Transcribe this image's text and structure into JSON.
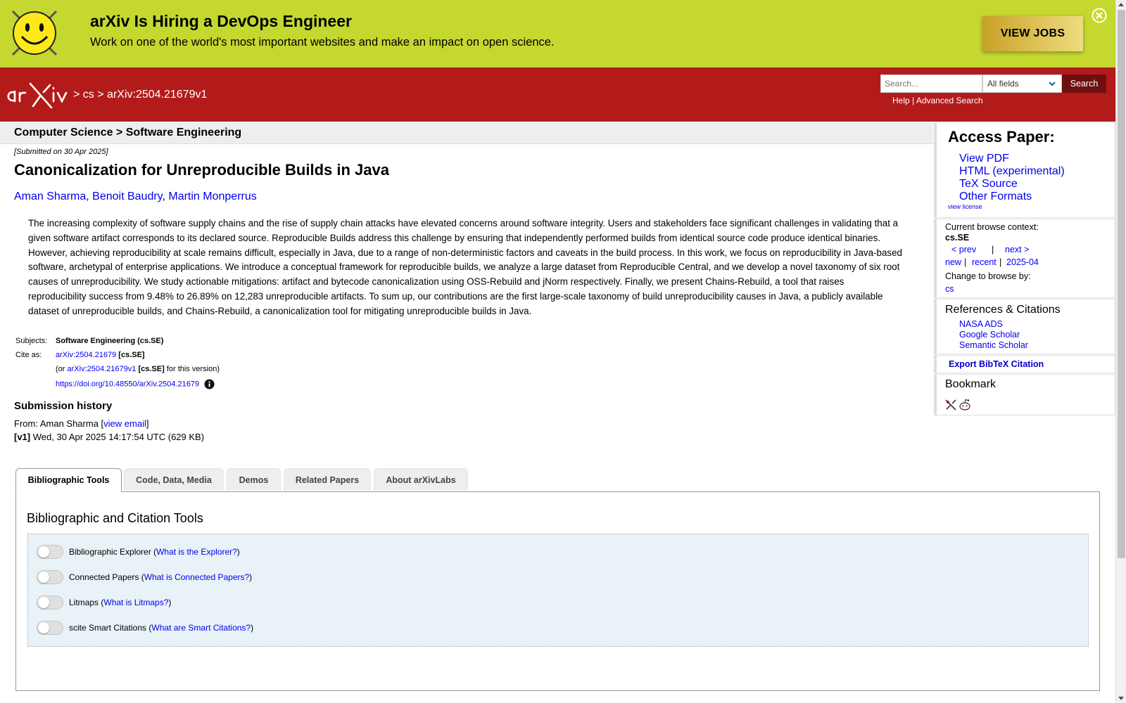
{
  "banner": {
    "title": "arXiv Is Hiring a DevOps Engineer",
    "text": "Work on one of the world's most important websites and make an impact on open science.",
    "button": "VIEW JOBS"
  },
  "header": {
    "crumb_sep": ">",
    "crumb_cs": "cs",
    "crumb_id": "arXiv:2504.21679v1",
    "search_placeholder": "Search...",
    "search_field": "All fields",
    "search_button": "Search",
    "help": "Help",
    "link_sep": "|",
    "advanced": "Advanced Search"
  },
  "paper": {
    "subject_bar": "Computer Science > Software Engineering",
    "submitted": "[Submitted on 30 Apr 2025]",
    "title": "Canonicalization for Unreproducible Builds in Java",
    "authors": [
      "Aman Sharma",
      "Benoit Baudry",
      "Martin Monperrus"
    ],
    "abstract": "The increasing complexity of software supply chains and the rise of supply chain attacks have elevated concerns around software integrity. Users and stakeholders face significant challenges in validating that a given software artifact corresponds to its declared source. Reproducible Builds address this challenge by ensuring that independently performed builds from identical source code produce identical binaries. However, achieving reproducibility at scale remains difficult, especially in Java, due to a range of non-deterministic factors and caveats in the build process. In this work, we focus on reproducibility in Java-based software, archetypal of enterprise applications. We introduce a conceptual framework for reproducible builds, we analyze a large dataset from Reproducible Central, and we develop a novel taxonomy of six root causes of unreproducibility. We study actionable mitigations: artifact and bytecode canonicalization using OSS-Rebuild and jNorm respectively. Finally, we present Chains-Rebuild, a tool that raises reproducibility success from 9.48% to 26.89% on 12,283 unreproducible artifacts. To sum up, our contributions are the first large-scale taxonomy of build unreproducibility causes in Java, a publicly available dataset of unreproducible builds, and Chains-Rebuild, a canonicalization tool for mitigating unreproducible builds in Java."
  },
  "meta": {
    "subjects_label": "Subjects:",
    "subjects_value": "Software Engineering (cs.SE)",
    "cite_label": "Cite as:",
    "cite_id": "arXiv:2504.21679",
    "cite_tag": "[cs.SE]",
    "or_prefix": "(or",
    "cite_id_v": "arXiv:2504.21679v1",
    "cite_tag_v": "[cs.SE]",
    "or_suffix": "for this version)",
    "doi": "https://doi.org/10.48550/arXiv.2504.21679"
  },
  "history": {
    "title": "Submission history",
    "from_prefix": "From: Aman Sharma [",
    "view_email": "view email",
    "from_suffix": "]",
    "v1_label": "[v1]",
    "v1_text": "Wed, 30 Apr 2025 14:17:54 UTC (629 KB)"
  },
  "sidebar": {
    "access_title": "Access Paper:",
    "formats": [
      "View PDF",
      "HTML (experimental)",
      "TeX Source",
      "Other Formats"
    ],
    "view_license": "view license",
    "context_label": "Current browse context:",
    "context_value": "cs.SE",
    "prev": "< prev",
    "pipe": "|",
    "next": "next >",
    "new": "new",
    "recent": "recent",
    "month": "2025-04",
    "change_label": "Change to browse by:",
    "change_value": "cs",
    "refs_title": "References & Citations",
    "refs": [
      "NASA ADS",
      "Google Scholar",
      "Semantic Scholar"
    ],
    "export": "Export BibTeX Citation",
    "bookmark_title": "Bookmark"
  },
  "tabs": [
    "Bibliographic Tools",
    "Code, Data, Media",
    "Demos",
    "Related Papers",
    "About arXivLabs"
  ],
  "tools": {
    "panel_title": "Bibliographic and Citation Tools",
    "items": [
      {
        "name": "Bibliographic Explorer",
        "help": "What is the Explorer?"
      },
      {
        "name": "Connected Papers",
        "help": "What is Connected Papers?"
      },
      {
        "name": "Litmaps",
        "help": "What is Litmaps?"
      },
      {
        "name": "scite Smart Citations",
        "help": "What are Smart Citations?"
      }
    ]
  },
  "colors": {
    "banner": "#c5d82f",
    "header": "#b31b1b",
    "link": "#0000ee"
  }
}
